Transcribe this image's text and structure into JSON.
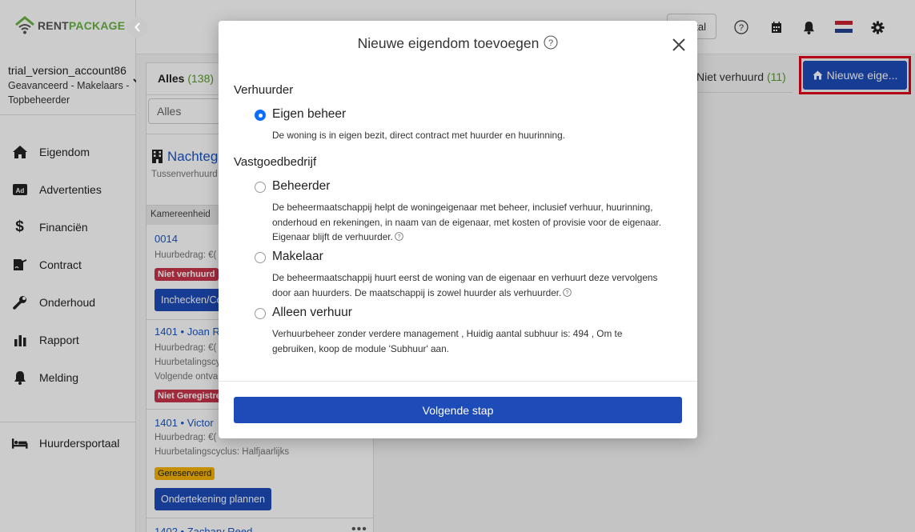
{
  "app": {
    "logo_part1": "RENT",
    "logo_part2": "PACKAGE"
  },
  "account": {
    "name": "trial_version_account86",
    "line2": "Geavanceerd - Makelaars -",
    "line3": "Topbeheerder"
  },
  "nav": [
    {
      "label": "Eigendom",
      "icon": "home-icon"
    },
    {
      "label": "Advertenties",
      "icon": "ad-icon"
    },
    {
      "label": "Financiën",
      "icon": "dollar-icon"
    },
    {
      "label": "Contract",
      "icon": "contract-icon"
    },
    {
      "label": "Onderhoud",
      "icon": "wrench-icon"
    },
    {
      "label": "Rapport",
      "icon": "chart-icon"
    },
    {
      "label": "Melding",
      "icon": "bell-icon"
    }
  ],
  "portal": {
    "label": "Huurdersportaal",
    "icon": "bed-icon"
  },
  "topbar": {
    "portal_btn": "tal"
  },
  "list": {
    "tab_label": "Alles",
    "tab_count": "(138)",
    "filter_value": "Alles",
    "group_title": "Nachtega",
    "group_sub": "Tussenverhuurd",
    "col_header": "Kamereenheid",
    "items": [
      {
        "title": "0014",
        "line1": "Huurbedrag: €(",
        "badge": "Niet verhuurd",
        "button": "Inchecken/Co"
      },
      {
        "title": "1401 • Joan R",
        "line1": "Huurbedrag: €(",
        "line2": "Huurbetalingscy",
        "line3": "Volgende ontva",
        "badge": "Niet Geregistree"
      },
      {
        "title": "1401 • Victor",
        "line1": "Huurbedrag: €(",
        "line2": "Huurbetalingscyclus: Halfjaarlijks",
        "badge": "Gereserveerd",
        "button": "Ondertekening plannen"
      },
      {
        "title": "1402 • Zachary Reed",
        "more": "•••"
      }
    ]
  },
  "right": {
    "tab_label": "Niet verhuurd",
    "tab_count": "(11)",
    "new_button": "Nieuwe eige..."
  },
  "modal": {
    "title": "Nieuwe eigendom toevoegen",
    "section1": "Verhuurder",
    "section2": "Vastgoedbedrijf",
    "options": [
      {
        "title": "Eigen beheer",
        "desc": "De woning is in eigen bezit, direct contract met huurder en huurinning.",
        "selected": true
      },
      {
        "title": "Beheerder",
        "desc": "De beheermaatschappij helpt de woningeigenaar met beheer, inclusief verhuur, huurinning, onderhoud en rekeningen, in naam van de eigenaar, met kosten of provisie voor de eigenaar. Eigenaar blijft de verhuurder.",
        "selected": false
      },
      {
        "title": "Makelaar",
        "desc": "De beheermaatschappij huurt eerst de woning van de eigenaar en verhuurt deze vervolgens door aan huurders. De maatschappij is zowel huurder als verhuurder.",
        "selected": false
      },
      {
        "title": "Alleen verhuur",
        "desc": "Verhuurbeheer zonder verdere management , Huidig aantal subhuur is: 494 , Om te gebruiken, koop de module 'Subhuur' aan.",
        "selected": false
      }
    ],
    "next_button": "Volgende stap"
  },
  "colors": {
    "primary": "#1d4bb8",
    "brand_green": "#69b244",
    "highlight": "#e0001a",
    "badge_red": "#c8354a",
    "badge_yellow": "#f5b301"
  }
}
